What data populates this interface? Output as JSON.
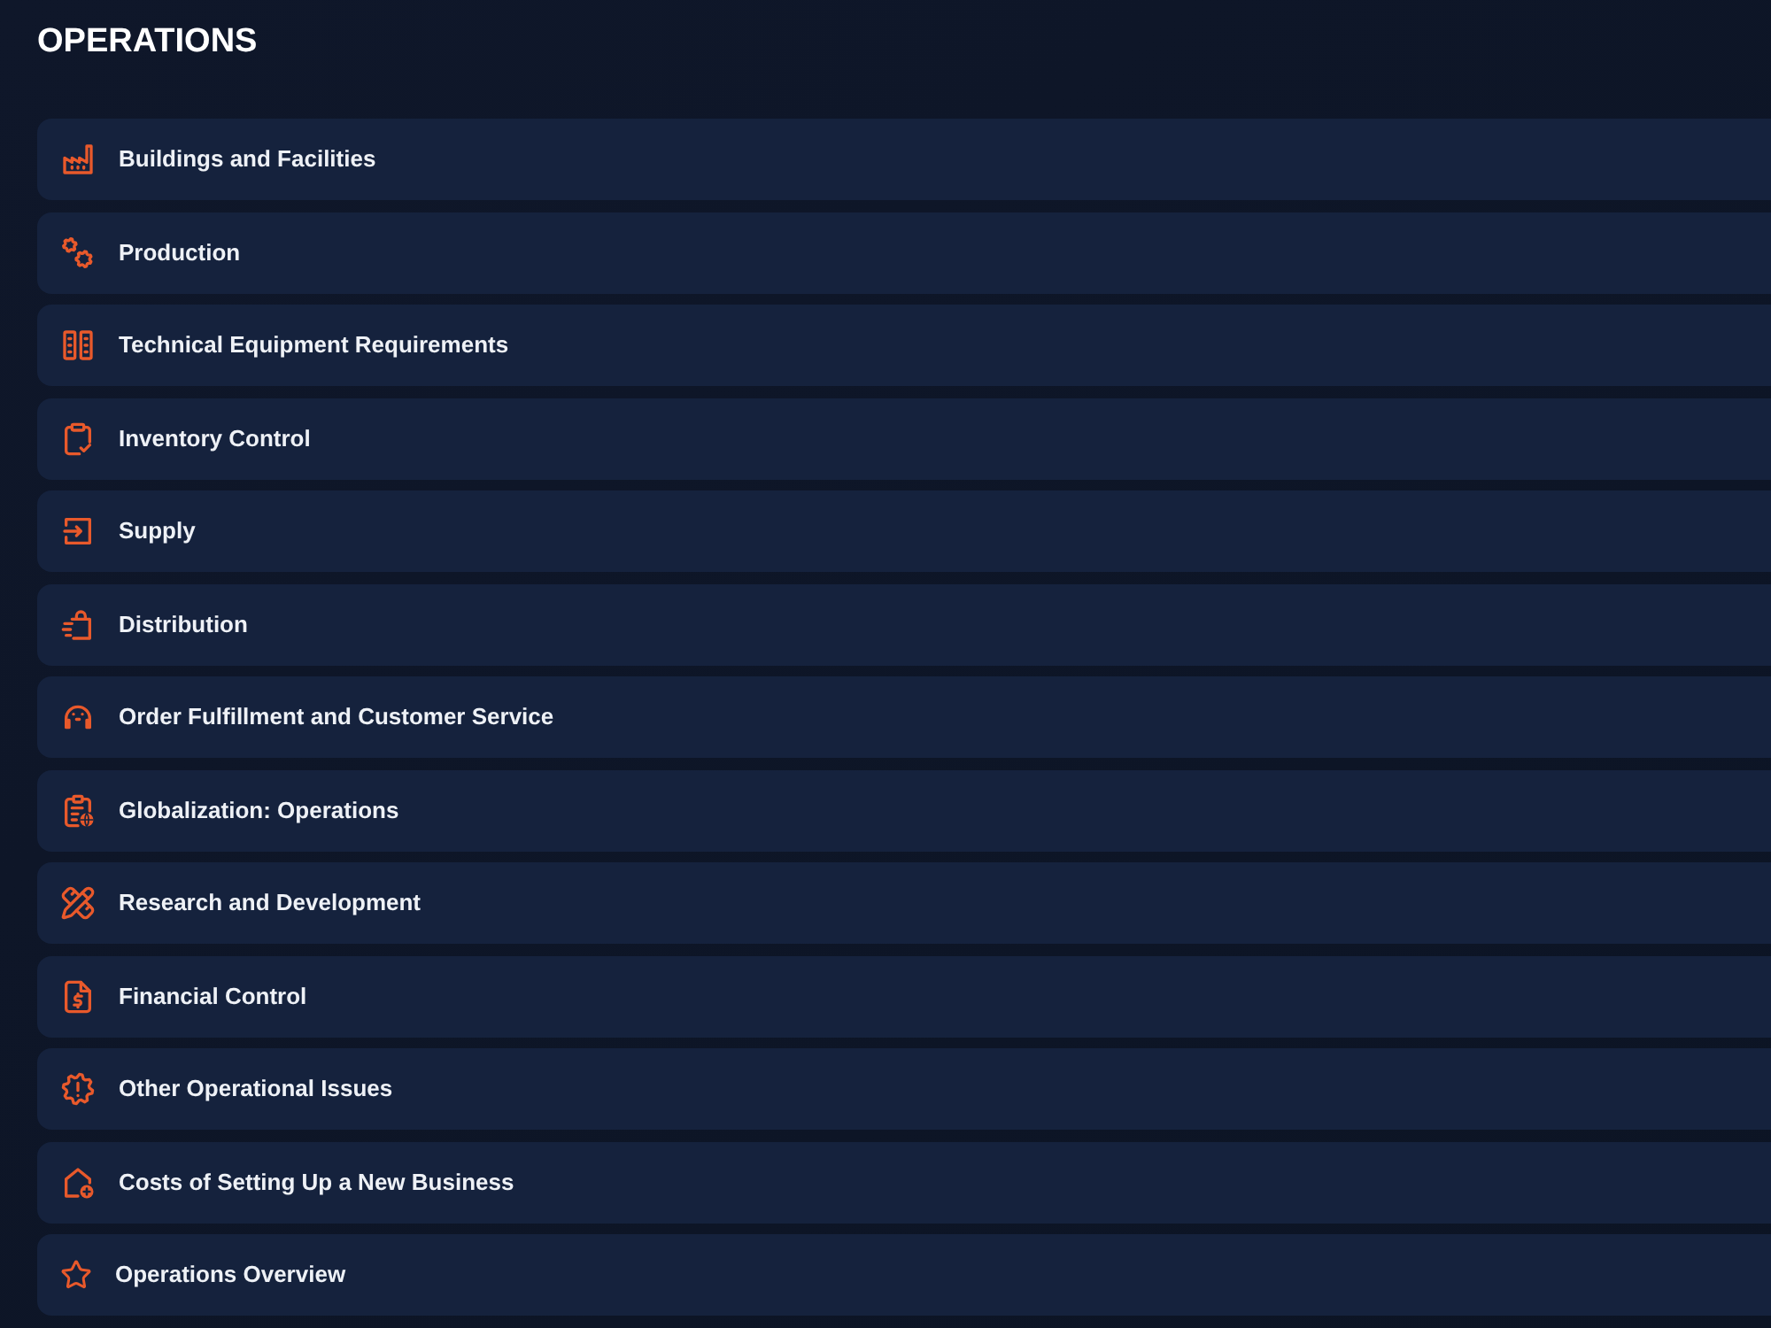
{
  "title": "OPERATIONS",
  "items": [
    {
      "label": "Buildings and Facilities"
    },
    {
      "label": "Production"
    },
    {
      "label": "Technical Equipment Requirements"
    },
    {
      "label": "Inventory Control"
    },
    {
      "label": "Supply"
    },
    {
      "label": "Distribution"
    },
    {
      "label": "Order Fulfillment and Customer Service"
    },
    {
      "label": "Globalization: Operations"
    },
    {
      "label": "Research and Development"
    },
    {
      "label": "Financial Control"
    },
    {
      "label": "Other Operational Issues"
    },
    {
      "label": "Costs of Setting Up a New Business"
    },
    {
      "label": "Operations Overview"
    }
  ]
}
